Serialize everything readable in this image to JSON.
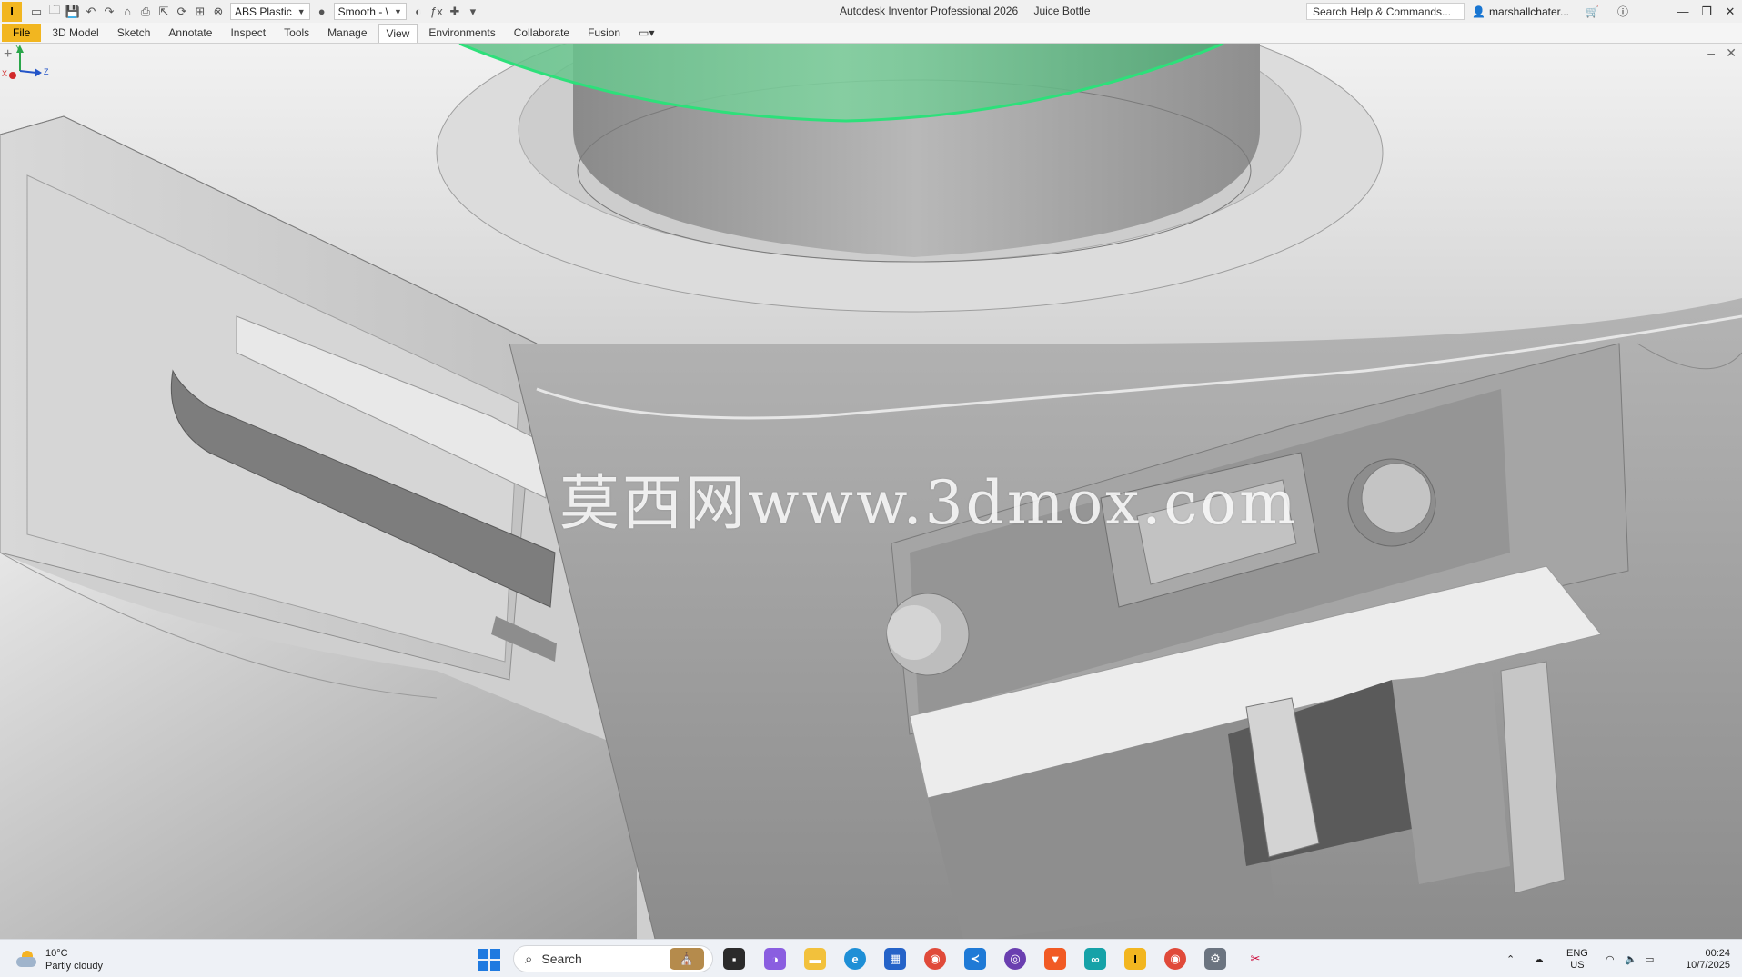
{
  "titlebar": {
    "material": "ABS Plastic",
    "visual_style": "Smooth - \\",
    "app_title": "Autodesk Inventor Professional 2026",
    "document_name": "Juice Bottle",
    "search_placeholder": "Search Help & Commands...",
    "user_name": "marshallchater...",
    "app_icon_letter": "I"
  },
  "tabs": [
    {
      "label": "File"
    },
    {
      "label": "3D Model"
    },
    {
      "label": "Sketch"
    },
    {
      "label": "Annotate"
    },
    {
      "label": "Inspect"
    },
    {
      "label": "Tools"
    },
    {
      "label": "Manage"
    },
    {
      "label": "View"
    },
    {
      "label": "Environments"
    },
    {
      "label": "Collaborate"
    },
    {
      "label": "Fusion"
    }
  ],
  "active_tab": "View",
  "viewport": {
    "watermark": "莫西网www.3dmox.com",
    "triad": {
      "x": "X",
      "y": "Y",
      "z": "Z"
    },
    "highlight_color": "#2de07a"
  },
  "taskbar": {
    "weather": {
      "temp": "10°C",
      "condition": "Partly cloudy"
    },
    "search_label": "Search",
    "language": {
      "line1": "ENG",
      "line2": "US"
    },
    "clock": {
      "time": "00:24",
      "date": "10/7/2025"
    }
  }
}
